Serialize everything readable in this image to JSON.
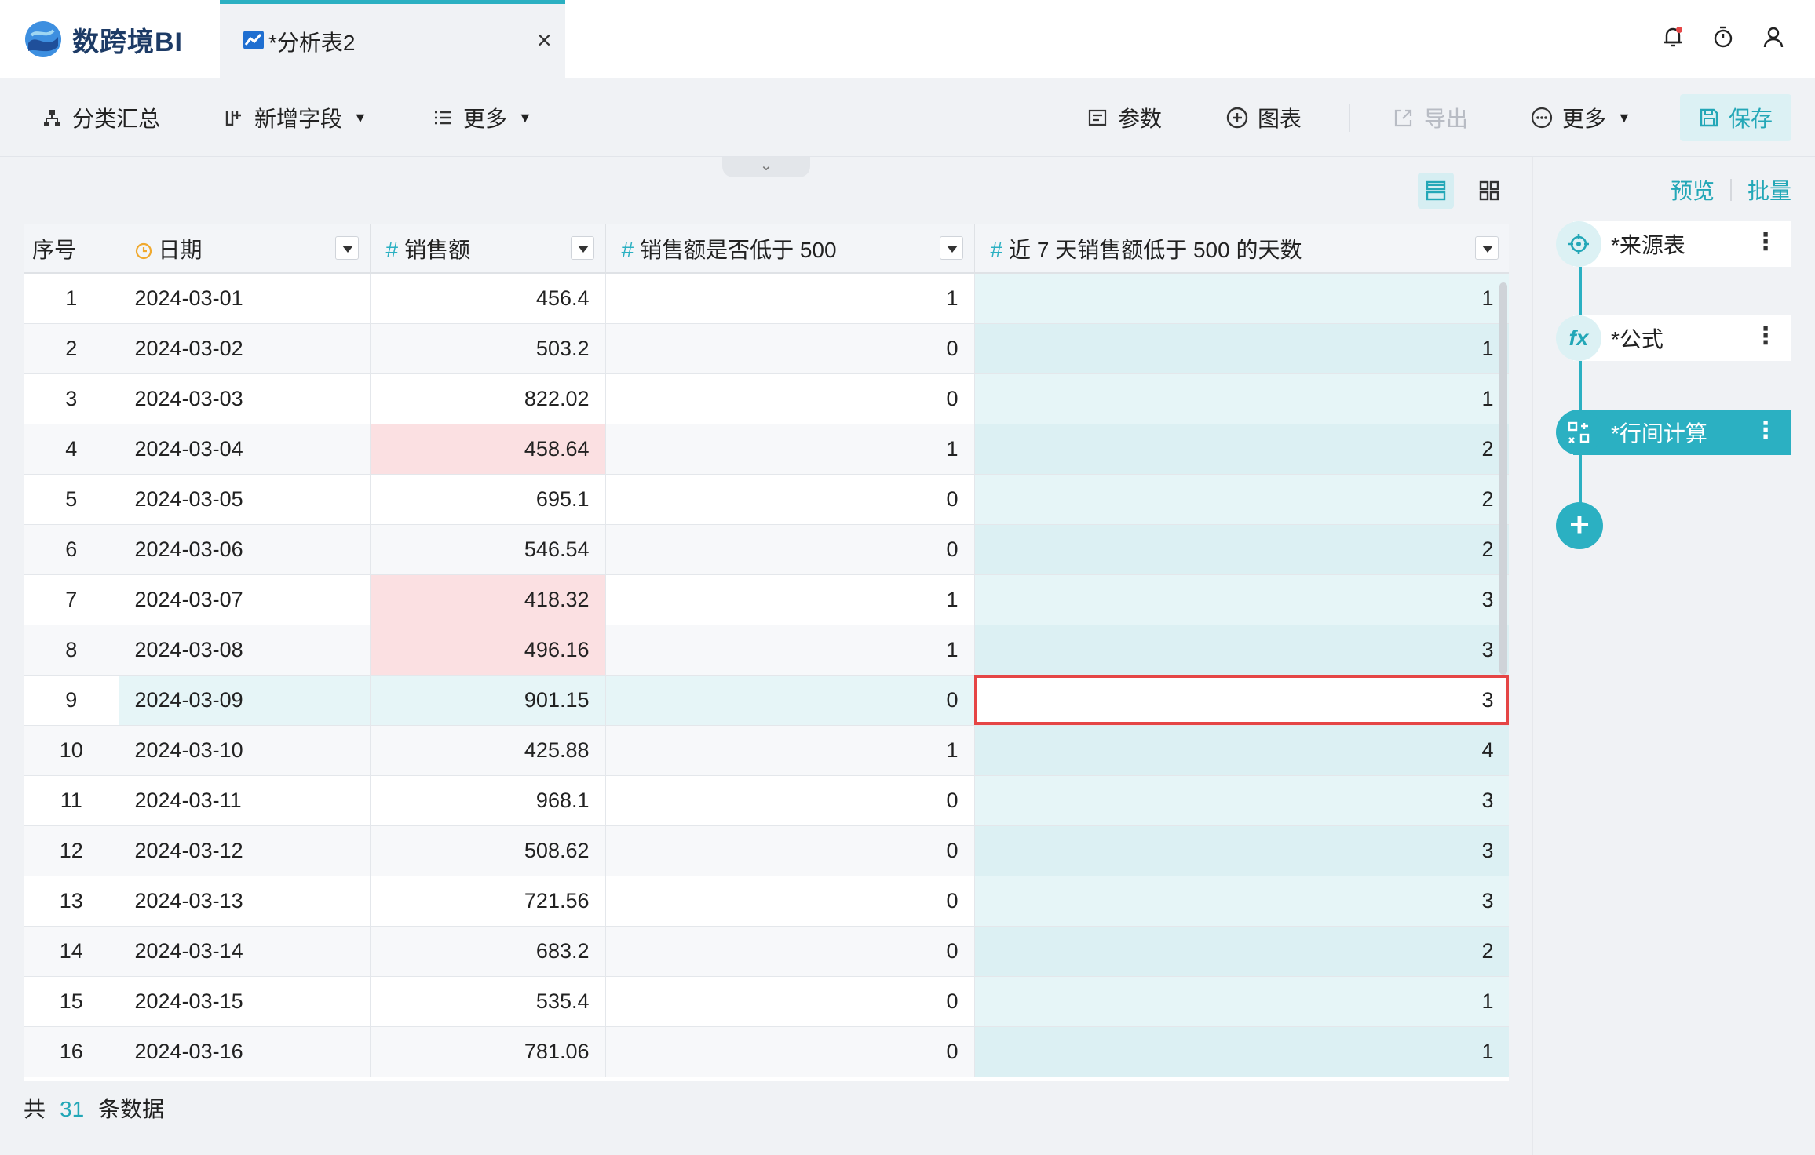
{
  "app": {
    "name": "数跨境BI",
    "tab_title": "*分析表2"
  },
  "toolbar": {
    "group_summary": "分类汇总",
    "add_field": "新增字段",
    "more_left": "更多",
    "params": "参数",
    "chart": "图表",
    "export": "导出",
    "more_right": "更多",
    "save": "保存"
  },
  "panel": {
    "preview": "预览",
    "batch": "批量",
    "steps": [
      {
        "label": "*来源表",
        "icon": "crosshair-icon"
      },
      {
        "label": "*公式",
        "icon": "fx-icon"
      },
      {
        "label": "*行间计算",
        "icon": "row-calc-icon",
        "active": true
      }
    ]
  },
  "table": {
    "columns": [
      "序号",
      "日期",
      "销售额",
      "销售额是否低于 500",
      "近 7 天销售额低于 500 的天数"
    ],
    "column_type_icons": [
      "",
      "clock-icon",
      "#",
      "#",
      "#"
    ],
    "rows": [
      [
        "1",
        "2024-03-01",
        "456.4",
        "1",
        "1"
      ],
      [
        "2",
        "2024-03-02",
        "503.2",
        "0",
        "1"
      ],
      [
        "3",
        "2024-03-03",
        "822.02",
        "0",
        "1"
      ],
      [
        "4",
        "2024-03-04",
        "458.64",
        "1",
        "2"
      ],
      [
        "5",
        "2024-03-05",
        "695.1",
        "0",
        "2"
      ],
      [
        "6",
        "2024-03-06",
        "546.54",
        "0",
        "2"
      ],
      [
        "7",
        "2024-03-07",
        "418.32",
        "1",
        "3"
      ],
      [
        "8",
        "2024-03-08",
        "496.16",
        "1",
        "3"
      ],
      [
        "9",
        "2024-03-09",
        "901.15",
        "0",
        "3"
      ],
      [
        "10",
        "2024-03-10",
        "425.88",
        "1",
        "4"
      ],
      [
        "11",
        "2024-03-11",
        "968.1",
        "0",
        "3"
      ],
      [
        "12",
        "2024-03-12",
        "508.62",
        "0",
        "3"
      ],
      [
        "13",
        "2024-03-13",
        "721.56",
        "0",
        "3"
      ],
      [
        "14",
        "2024-03-14",
        "683.2",
        "0",
        "2"
      ],
      [
        "15",
        "2024-03-15",
        "535.4",
        "0",
        "1"
      ],
      [
        "16",
        "2024-03-16",
        "781.06",
        "0",
        "1"
      ]
    ],
    "highlight_sales_rows": [
      3,
      6,
      7
    ],
    "selected_row": 8,
    "focus_row": 8,
    "accent_color": "#2bb0c2",
    "highlight_color": "#fbe0e2",
    "focus_border_color": "#e54545"
  },
  "footer": {
    "prefix": "共",
    "count": "31",
    "suffix": "条数据"
  }
}
